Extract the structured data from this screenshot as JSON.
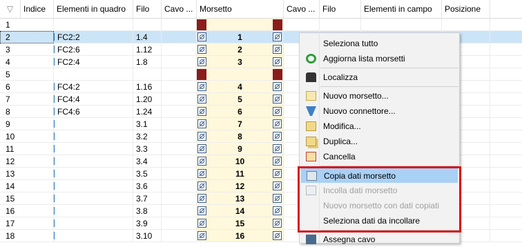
{
  "columns": [
    "Indice",
    "Elementi in quadro",
    "Filo",
    "Cavo ...",
    "Morsetto",
    "Cavo ...",
    "Filo",
    "Elementi in campo",
    "Posizione"
  ],
  "rows": [
    {
      "idx": "1",
      "q": "",
      "filo": "",
      "m": "",
      "block": true
    },
    {
      "idx": "2",
      "q": "FC2:2",
      "filo": "1.4",
      "m": "1",
      "selected": true
    },
    {
      "idx": "3",
      "q": "FC2:6",
      "filo": "1.12",
      "m": "2"
    },
    {
      "idx": "4",
      "q": "FC2:4",
      "filo": "1.8",
      "m": "3"
    },
    {
      "idx": "5",
      "q": "",
      "filo": "",
      "m": "",
      "block": true
    },
    {
      "idx": "6",
      "q": "FC4:2",
      "filo": "1.16",
      "m": "4"
    },
    {
      "idx": "7",
      "q": "FC4:4",
      "filo": "1.20",
      "m": "5"
    },
    {
      "idx": "8",
      "q": "FC4:6",
      "filo": "1.24",
      "m": "6"
    },
    {
      "idx": "9",
      "q": "",
      "filo": "3.1",
      "m": "7"
    },
    {
      "idx": "10",
      "q": "",
      "filo": "3.2",
      "m": "8"
    },
    {
      "idx": "11",
      "q": "",
      "filo": "3.3",
      "m": "9"
    },
    {
      "idx": "12",
      "q": "",
      "filo": "3.4",
      "m": "10"
    },
    {
      "idx": "13",
      "q": "",
      "filo": "3.5",
      "m": "11"
    },
    {
      "idx": "14",
      "q": "",
      "filo": "3.6",
      "m": "12"
    },
    {
      "idx": "15",
      "q": "",
      "filo": "3.7",
      "m": "13"
    },
    {
      "idx": "16",
      "q": "",
      "filo": "3.8",
      "m": "14"
    },
    {
      "idx": "17",
      "q": "",
      "filo": "3.9",
      "m": "15"
    },
    {
      "idx": "18",
      "q": "",
      "filo": "3.10",
      "m": "16"
    }
  ],
  "context_menu": {
    "items": [
      {
        "label": "Seleziona tutto",
        "icon": "none"
      },
      {
        "label": "Aggiorna lista morsetti",
        "icon": "refresh-icon"
      },
      {
        "sep": true
      },
      {
        "label": "Localizza",
        "icon": "binoculars-icon"
      },
      {
        "sep": true
      },
      {
        "label": "Nuovo morsetto...",
        "icon": "new-terminal-icon"
      },
      {
        "label": "Nuovo connettore...",
        "icon": "connector-icon"
      },
      {
        "label": "Modifica...",
        "icon": "edit-icon"
      },
      {
        "label": "Duplica...",
        "icon": "duplicate-icon"
      },
      {
        "label": "Cancella",
        "icon": "delete-icon"
      },
      {
        "sep": true
      },
      {
        "label": "Copia dati morsetto",
        "icon": "copy-data-icon",
        "highlighted": true
      },
      {
        "label": "Incolla dati morsetto",
        "icon": "paste-data-icon",
        "disabled": true
      },
      {
        "label": "Nuovo morsetto con dati copiati",
        "icon": "none",
        "disabled": true
      },
      {
        "label": "Seleziona dati da incollare",
        "icon": "none"
      },
      {
        "sep": true
      },
      {
        "label": "Assegna cavo",
        "icon": "cable-icon"
      }
    ]
  },
  "colors": {
    "selection": "#cce4f7",
    "terminal_column": "#fff8dc",
    "highlight_box": "#d6151a",
    "block_marker": "#8b1c1c"
  }
}
